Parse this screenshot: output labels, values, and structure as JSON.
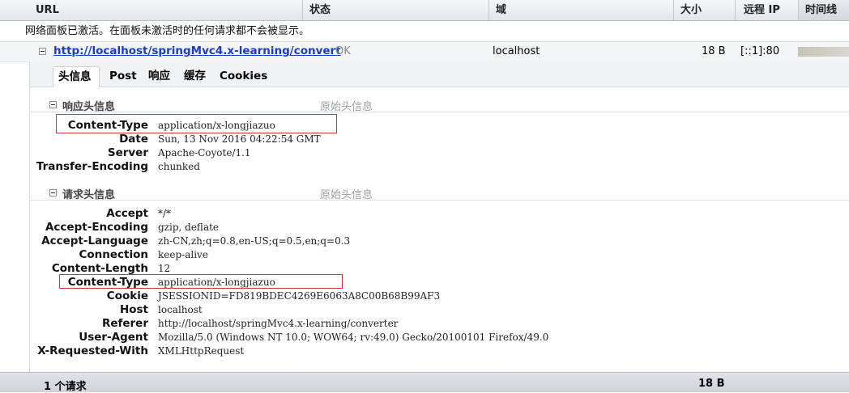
{
  "columns": {
    "url": "URL",
    "status": "状态",
    "domain": "域",
    "size": "大小",
    "remote_ip": "远程 IP",
    "timeline": "时间线"
  },
  "notice": "网络面板已激活。在面板未激活时的任何请求都不会被显示。",
  "request": {
    "url": "http://localhost/springMvc4.x-learning/convert",
    "status": "OK",
    "domain": "localhost",
    "size": "18 B",
    "remote_ip": "[::1]:80"
  },
  "tabs": [
    {
      "label": "头信息",
      "active": true
    },
    {
      "label": "Post",
      "active": false
    },
    {
      "label": "响应",
      "active": false
    },
    {
      "label": "缓存",
      "active": false
    },
    {
      "label": "Cookies",
      "active": false
    }
  ],
  "response_headers": {
    "title": "响应头信息",
    "raw_link": "原始头信息",
    "items": [
      {
        "name": "Content-Type",
        "value": "application/x-longjiazuo",
        "highlighted": true
      },
      {
        "name": "Date",
        "value": "Sun, 13 Nov 2016 04:22:54 GMT"
      },
      {
        "name": "Server",
        "value": "Apache-Coyote/1.1"
      },
      {
        "name": "Transfer-Encoding",
        "value": "chunked"
      }
    ]
  },
  "request_headers": {
    "title": "请求头信息",
    "raw_link": "原始头信息",
    "items": [
      {
        "name": "Accept",
        "value": "*/*"
      },
      {
        "name": "Accept-Encoding",
        "value": "gzip, deflate"
      },
      {
        "name": "Accept-Language",
        "value": "zh-CN,zh;q=0.8,en-US;q=0.5,en;q=0.3"
      },
      {
        "name": "Connection",
        "value": "keep-alive"
      },
      {
        "name": "Content-Length",
        "value": "12"
      },
      {
        "name": "Content-Type",
        "value": "application/x-longjiazuo",
        "highlighted": true
      },
      {
        "name": "Cookie",
        "value": "JSESSIONID=FD819BDEC4269E6063A8C00B68B99AF3"
      },
      {
        "name": "Host",
        "value": "localhost"
      },
      {
        "name": "Referer",
        "value": "http://localhost/springMvc4.x-learning/converter"
      },
      {
        "name": "User-Agent",
        "value": "Mozilla/5.0 (Windows NT 10.0; WOW64; rv:49.0) Gecko/20100101 Firefox/49.0"
      },
      {
        "name": "X-Requested-With",
        "value": "XMLHttpRequest"
      }
    ]
  },
  "footer": {
    "request_count": "1 个请求",
    "total_size": "18 B"
  },
  "colors": {
    "link": "#1b3bcc",
    "highlight_border": "#d8323c"
  },
  "icons": {
    "expand_toggle": "minus-box-icon"
  }
}
